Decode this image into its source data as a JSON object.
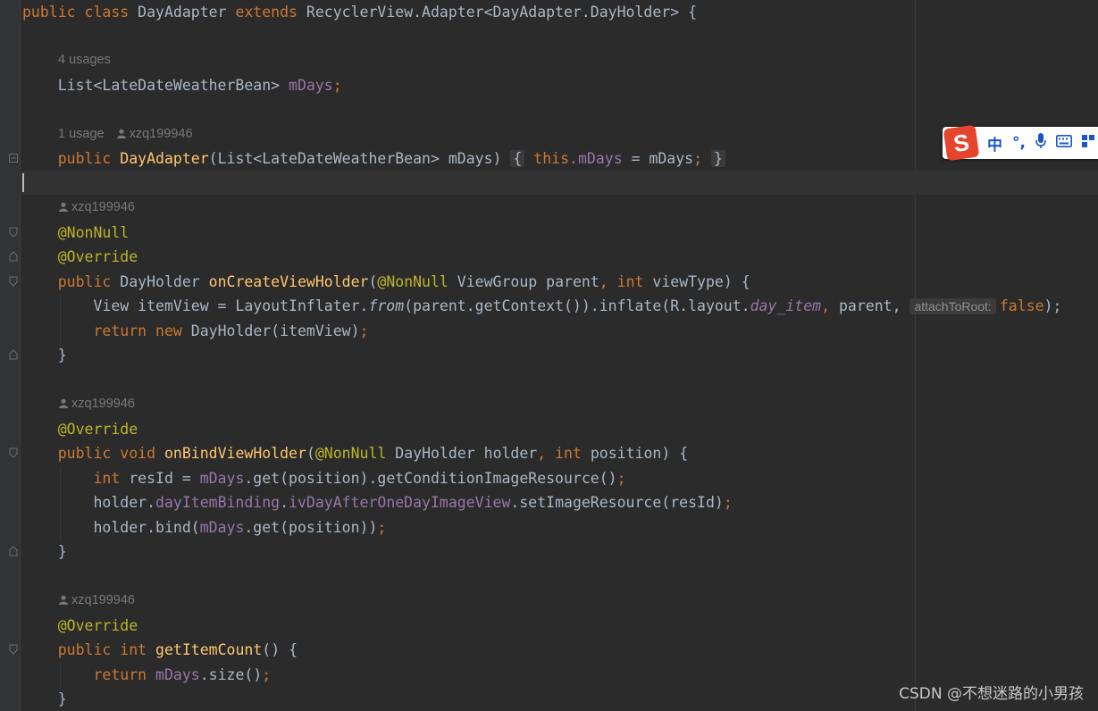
{
  "class_decl": {
    "public": "public",
    "class": "class",
    "name": "DayAdapter",
    "extends": "extends",
    "parent": "RecyclerView.Adapter<DayAdapter.DayHolder>",
    "brace": " {"
  },
  "hints": {
    "usages4": "4 usages",
    "usage1": "1 usage",
    "author": "xzq199946"
  },
  "field": {
    "type": "List<LateDateWeatherBean>",
    "name": "mDays",
    "semi": ";"
  },
  "ctor": {
    "public": "public",
    "name": "DayAdapter",
    "params": "(List<LateDateWeatherBean> mDays)",
    "open": "{",
    "this": "this",
    "dot_field": ".mDays",
    "assign": " = mDays",
    "semi": ";",
    "close": "}"
  },
  "ann": {
    "nonnull": "@NonNull",
    "override": "@Override"
  },
  "m1": {
    "public": "public",
    "ret": "DayHolder",
    "name": "onCreateViewHolder",
    "p_open": "(",
    "p_ann": "@NonNull",
    "p1": " ViewGroup parent",
    "comma": ",",
    "int": "int",
    "p2": " viewType) {",
    "b1_a": "View itemView = LayoutInflater.",
    "b1_from": "from",
    "b1_b": "(parent.getContext()).inflate(R.layout.",
    "b1_item": "day_item",
    "b1_c": " parent, ",
    "b1_hint": "attachToRoot:",
    "b1_false": "false",
    "b1_d": ");",
    "b2_return": "return",
    "b2_new": "new",
    "b2_rest": " DayHolder(itemView)",
    "close": "}"
  },
  "m2": {
    "public": "public",
    "void": "void",
    "name": "onBindViewHolder",
    "p_ann": "@NonNull",
    "p1": " DayHolder holder",
    "int": "int",
    "p2": " position) {",
    "b1_int": "int",
    "b1_a": " resId = ",
    "b1_field": "mDays",
    "b1_b": ".get(position).getConditionImageResource()",
    "b2_a": "holder.",
    "b2_field1": "dayItemBinding",
    "b2_dot": ".",
    "b2_field2": "ivDayAfterOneDayImageView",
    "b2_b": ".setImageResource(resId)",
    "b3_a": "holder.bind(",
    "b3_field": "mDays",
    "b3_b": ".get(position))",
    "close": "}"
  },
  "m3": {
    "public": "public",
    "int": "int",
    "name": "getItemCount",
    "rest": "() {",
    "b1_return": "return",
    "b1_field": "mDays",
    "b1_b": ".size()",
    "close": "}"
  },
  "ime": {
    "logo": "S",
    "item1": "中",
    "item2": "°,"
  },
  "watermark": "CSDN @不想迷路的小男孩"
}
